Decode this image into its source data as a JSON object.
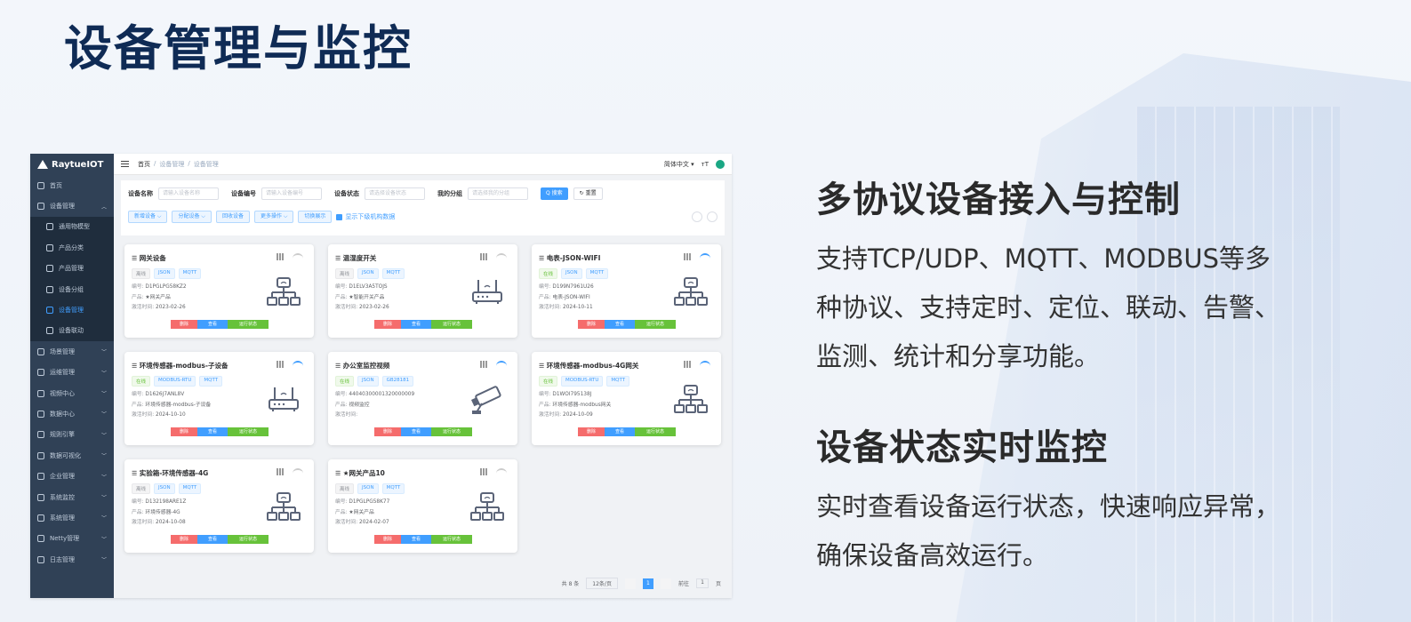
{
  "page": {
    "title": "设备管理与监控"
  },
  "features": [
    {
      "heading": "多协议设备接入与控制",
      "lines": [
        "支持TCP/UDP、MQTT、MODBUS等多",
        "种协议、支持定时、定位、联动、告警、",
        "监测、统计和分享功能。"
      ]
    },
    {
      "heading": "设备状态实时监控",
      "lines": [
        "实时查看设备运行状态，快速响应异常，",
        "确保设备高效运行。"
      ]
    }
  ],
  "app": {
    "logo": "RaytueIOT",
    "sidebar": [
      {
        "label": "首页",
        "icon": "dashboard-icon"
      },
      {
        "label": "设备管理",
        "icon": "device-icon",
        "expanded": true
      },
      {
        "label": "通用物模型",
        "icon": "model-icon",
        "sub": true
      },
      {
        "label": "产品分类",
        "icon": "category-icon",
        "sub": true
      },
      {
        "label": "产品管理",
        "icon": "product-icon",
        "sub": true
      },
      {
        "label": "设备分组",
        "icon": "group-icon",
        "sub": true
      },
      {
        "label": "设备管理",
        "icon": "list-icon",
        "sub": true,
        "active": true
      },
      {
        "label": "设备联动",
        "icon": "link-icon",
        "sub": true
      },
      {
        "label": "场景管理",
        "icon": "scene-icon"
      },
      {
        "label": "运维管理",
        "icon": "ops-icon"
      },
      {
        "label": "视频中心",
        "icon": "video-icon"
      },
      {
        "label": "数据中心",
        "icon": "data-icon"
      },
      {
        "label": "规则引擎",
        "icon": "rule-icon"
      },
      {
        "label": "数据可视化",
        "icon": "chart-icon"
      },
      {
        "label": "企业管理",
        "icon": "company-icon"
      },
      {
        "label": "系统监控",
        "icon": "monitor-icon"
      },
      {
        "label": "系统管理",
        "icon": "settings-icon"
      },
      {
        "label": "Netty管理",
        "icon": "netty-icon"
      },
      {
        "label": "日志管理",
        "icon": "log-icon"
      }
    ],
    "navbar": {
      "breadcrumb": [
        "首页",
        "设备管理",
        "设备管理"
      ],
      "language": "简体中文 ▾",
      "font_size_icon": "ᴛT"
    },
    "search": {
      "name_label": "设备名称",
      "name_placeholder": "请输入设备名称",
      "serial_label": "设备编号",
      "serial_placeholder": "请输入设备编号",
      "status_label": "设备状态",
      "status_placeholder": "请选择设备状态",
      "group_label": "我的分组",
      "group_placeholder": "请选择我的分组",
      "search_button": "Q 搜索",
      "reset_button": "↻ 重置"
    },
    "toolbar": {
      "add": "新增设备 ⌵",
      "assign": "分配设备 ⌵",
      "recycle": "回收设备",
      "more": "更多操作 ⌵",
      "toggle": "切换展示",
      "show_sub": "显示下级机构数据"
    },
    "cards": [
      {
        "title": "网关设备",
        "online": false,
        "tags": [
          "离线",
          "JSON",
          "MQTT"
        ],
        "serial": "D1PGLPG58KZ2",
        "product": "★网关产品",
        "activated": "2023-02-26",
        "img": "gateway"
      },
      {
        "title": "温湿度开关",
        "online": false,
        "tags": [
          "离线",
          "JSON",
          "MQTT"
        ],
        "serial": "D1ELV3A5TOJS",
        "product": "★智能开关产品",
        "activated": "2023-02-26",
        "img": "router"
      },
      {
        "title": "电表-JSON-WIFI",
        "online": true,
        "tags": [
          "在线",
          "JSON",
          "MQTT"
        ],
        "serial": "D199N7961U26",
        "product": "电表-JSON-WIFI",
        "activated": "2024-10-11",
        "img": "gateway"
      },
      {
        "title": "环境传感器-modbus-子设备",
        "online": true,
        "tags": [
          "在线",
          "MODBUS-RTU",
          "MQTT"
        ],
        "serial": "D1626J7ANL8V",
        "product": "环境传感器-modbus-子设备",
        "activated": "2024-10-10",
        "img": "router"
      },
      {
        "title": "办公室监控视频",
        "online": true,
        "tags": [
          "在线",
          "JSON",
          "GB28181"
        ],
        "serial": "44040300001320000009",
        "product": "视频监控",
        "activated": "",
        "img": "camera"
      },
      {
        "title": "环境传感器-modbus-4G网关",
        "online": true,
        "tags": [
          "在线",
          "MODBUS-RTU",
          "MQTT"
        ],
        "serial": "D1WOI795138J",
        "product": "环境传感器-modbus网关",
        "activated": "2024-10-09",
        "img": "gateway"
      },
      {
        "title": "实验箱-环境传感器-4G",
        "online": false,
        "tags": [
          "离线",
          "JSON",
          "MQTT"
        ],
        "serial": "D132198ARE1Z",
        "product": "环境传感器-4G",
        "activated": "2024-10-08",
        "img": "gateway"
      },
      {
        "title": "★网关产品10",
        "online": false,
        "tags": [
          "离线",
          "JSON",
          "MQTT"
        ],
        "serial": "D1PGLPG58K77",
        "product": "★网关产品",
        "activated": "2024-02-07",
        "img": "gateway"
      }
    ],
    "card_labels": {
      "serial": "编号:",
      "product": "产品:",
      "activated": "激活时间:",
      "delete": "删除",
      "view": "查看",
      "run": "运行状态"
    },
    "pager": {
      "total": "共 8 条",
      "size": "12条/页",
      "current": "1",
      "goto_prefix": "前往",
      "goto_value": "1",
      "goto_suffix": "页"
    }
  }
}
